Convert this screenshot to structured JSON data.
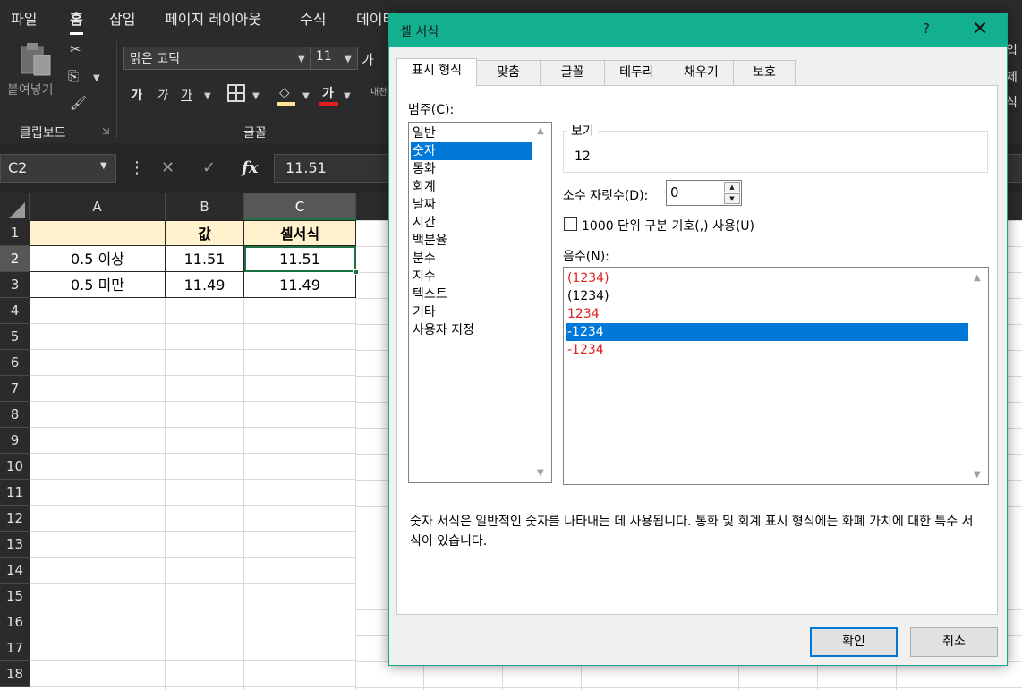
{
  "ribbon": {
    "menu_tabs": [
      "파일",
      "홈",
      "삽입",
      "페이지 레이아웃",
      "수식",
      "데이터"
    ],
    "active_tab": "홈",
    "clipboard": {
      "paste_label": "붙여넣기",
      "group_label": "클립보드"
    },
    "font": {
      "family": "맑은 고딕",
      "size": "11",
      "bold_label": "가",
      "italic_label": "가",
      "underline_label": "가",
      "grow_label": "가",
      "font_color_label": "가",
      "group_label": "글꼴"
    },
    "right_fragments": [
      "입",
      "제",
      "식"
    ],
    "wrap_text_fragment": "내천"
  },
  "formula_bar": {
    "name_box": "C2",
    "formula": "11.51",
    "fx_label": "fx"
  },
  "sheet": {
    "columns": [
      "A",
      "B",
      "C"
    ],
    "rows": [
      "1",
      "2",
      "3",
      "4",
      "5",
      "6",
      "7",
      "8",
      "9",
      "10",
      "11",
      "12",
      "13",
      "14",
      "15",
      "16",
      "17",
      "18"
    ],
    "selected_column": "C",
    "selected_row": "2",
    "cells": {
      "B1": "값",
      "C1": "셀서식",
      "A2": "0.5 이상",
      "B2": "11.51",
      "C2": "11.51",
      "A3": "0.5 미만",
      "B3": "11.49",
      "C3": "11.49"
    }
  },
  "dialog": {
    "title": "셀 서식",
    "help": "?",
    "close": "✕",
    "tabs": [
      "표시 형식",
      "맞춤",
      "글꼴",
      "테두리",
      "채우기",
      "보호"
    ],
    "active_tab": "표시 형식",
    "category_label": "범주(C):",
    "categories": [
      "일반",
      "숫자",
      "통화",
      "회계",
      "날짜",
      "시간",
      "백분율",
      "분수",
      "지수",
      "텍스트",
      "기타",
      "사용자 지정"
    ],
    "selected_category": "숫자",
    "preview_label": "보기",
    "preview_value": "12",
    "decimal_label": "소수 자릿수(D):",
    "decimal_value": "0",
    "thousands_label": "1000 단위 구분 기호(,) 사용(U)",
    "thousands_checked": false,
    "negative_label": "음수(N):",
    "negative_options": [
      {
        "text": "(1234)",
        "color": "#e0201f"
      },
      {
        "text": "(1234)",
        "color": "#000000"
      },
      {
        "text": "1234",
        "color": "#e0201f"
      },
      {
        "text": "-1234",
        "color": "#000000"
      },
      {
        "text": "-1234",
        "color": "#e0201f"
      }
    ],
    "selected_negative_index": 3,
    "description": "숫자 서식은 일반적인 숫자를 나타내는 데 사용됩니다. 통화 및 회계 표시 형식에는 화폐 가치에 대한 특수 서식이 있습니다.",
    "ok_label": "확인",
    "cancel_label": "취소"
  }
}
